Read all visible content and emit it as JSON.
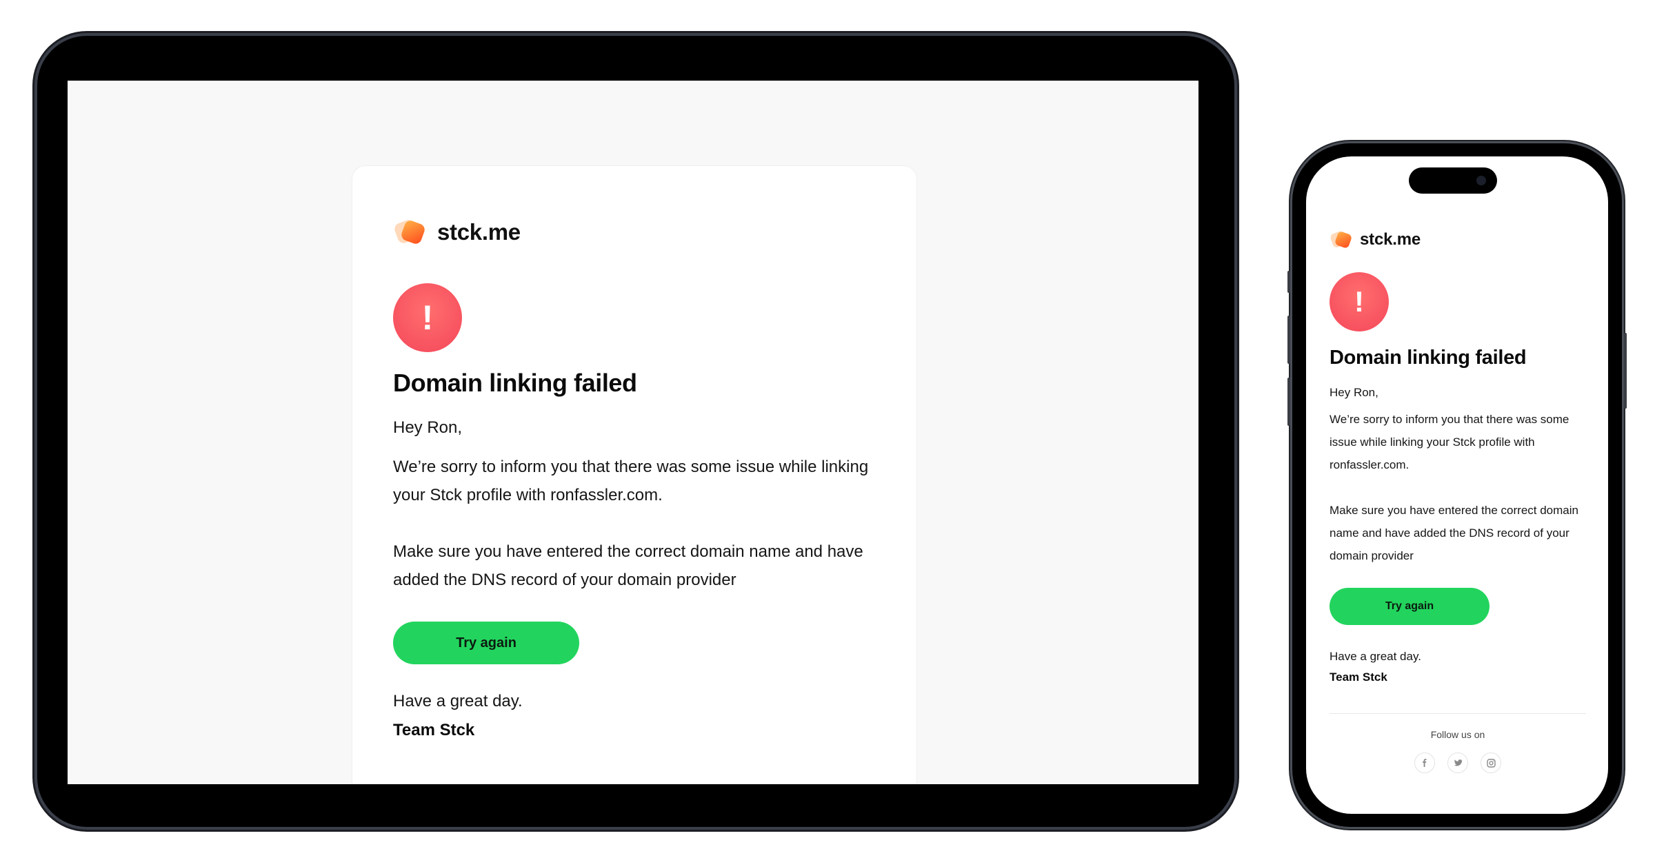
{
  "email": {
    "brand_name": "stck.me",
    "title": "Domain linking failed",
    "alert_symbol": "!",
    "greeting": "Hey Ron,",
    "paragraph1": "We’re sorry to inform you that there was some issue while linking your Stck profile with ronfassler.com.",
    "paragraph2": "Make sure you have entered the correct domain name and have added the DNS record of your domain provider",
    "button_label": "Try again",
    "signoff": "Have a great day.",
    "team": "Team Stck",
    "follow_label": "Follow us on",
    "social_icons": [
      "facebook-icon",
      "twitter-icon",
      "instagram-icon"
    ]
  },
  "colors": {
    "accent_green": "#22d45d",
    "alert_red": "#f4475a",
    "logo_orange": "#ff6a1a",
    "page_bg": "#f8f8f8"
  }
}
